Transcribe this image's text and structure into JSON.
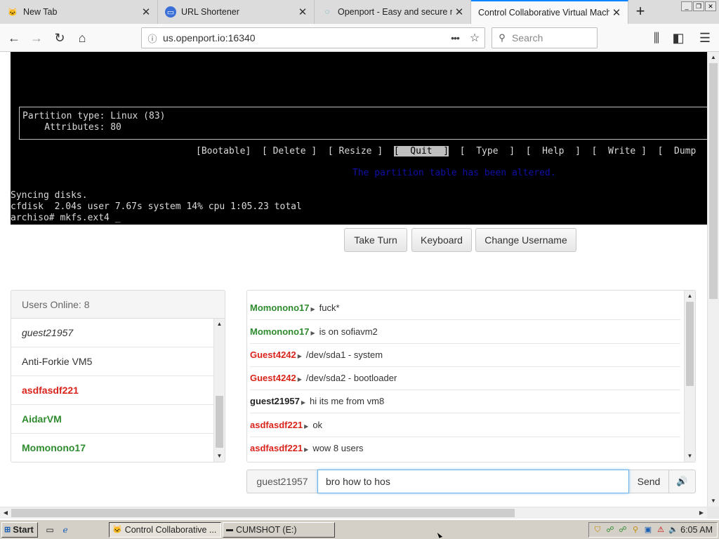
{
  "browser": {
    "tabs": [
      {
        "title": "New Tab",
        "icon": "globe-icon"
      },
      {
        "title": "URL Shortener",
        "icon": "chain-icon"
      },
      {
        "title": "Openport - Easy and secure re",
        "icon": "openport-icon"
      },
      {
        "title": "Control Collaborative Virtual Mach",
        "icon": "none",
        "active": true
      }
    ],
    "url": "us.openport.io:16340",
    "search_placeholder": "Search",
    "window_controls": [
      "_",
      "❐",
      "✕"
    ]
  },
  "terminal": {
    "partition_type": "Partition type: Linux (83)",
    "attributes": "    Attributes: 80",
    "menu_items": [
      "[Bootable]",
      "[ Delete ]",
      "[ Resize ]",
      "[  Quit  ]",
      "[  Type  ]",
      "[  Help  ]",
      "[  Write ]",
      "[  Dump"
    ],
    "selected_menu": "[  Quit  ]",
    "status_message": "The partition table has been altered.",
    "lines": [
      "Syncing disks.",
      "cfdisk  2.04s user 7.67s system 14% cpu 1:05.23 total",
      "archiso# mkfs.ext4 _"
    ]
  },
  "controls": {
    "take_turn": "Take Turn",
    "keyboard": "Keyboard",
    "change_username": "Change Username"
  },
  "users": {
    "header": "Users Online: 8",
    "list": [
      {
        "name": "guest21957",
        "style": "italic"
      },
      {
        "name": "Anti-Forkie VM5",
        "style": "normal"
      },
      {
        "name": "asdfasdf221",
        "style": "red"
      },
      {
        "name": "AidarVM",
        "style": "green"
      },
      {
        "name": "Momonono17",
        "style": "green"
      }
    ]
  },
  "chat": {
    "messages": [
      {
        "user": "Momonono17",
        "text": "fuck*",
        "color": "#2e8b2e"
      },
      {
        "user": "Momonono17",
        "text": "is on sofiavm2",
        "color": "#2e8b2e"
      },
      {
        "user": "Guest4242",
        "text": "/dev/sda1 - system",
        "color": "#d9241b"
      },
      {
        "user": "Guest4242",
        "text": "/dev/sda2 - bootloader",
        "color": "#d9241b"
      },
      {
        "user": "guest21957",
        "text": "hi its me from vm8",
        "color": "#222222"
      },
      {
        "user": "asdfasdf221",
        "text": "ok",
        "color": "#d9241b"
      },
      {
        "user": "asdfasdf221",
        "text": "wow 8 users",
        "color": "#d9241b"
      }
    ],
    "compose_username": "guest21957",
    "compose_value": "bro how to hos",
    "send_label": "Send"
  },
  "taskbar": {
    "start_label": "Start",
    "tasks": [
      {
        "label": "Control Collaborative ...",
        "pressed": true
      },
      {
        "label": "CUMSHOT (E:)",
        "pressed": false
      }
    ],
    "clock": "6:05 AM"
  }
}
